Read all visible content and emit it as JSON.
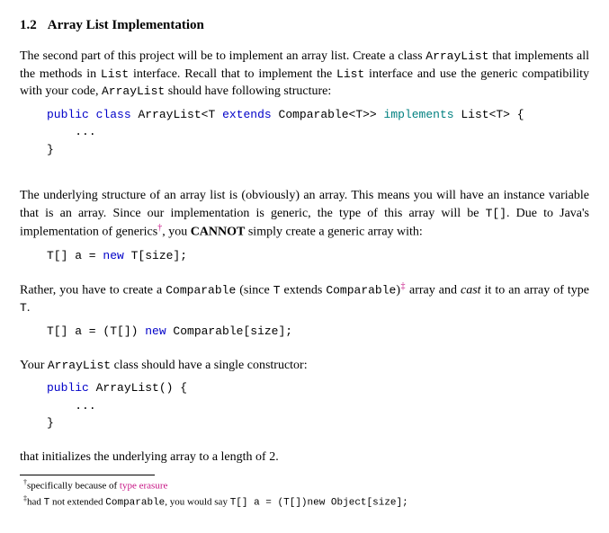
{
  "section": {
    "number": "1.2",
    "title": "Array List Implementation"
  },
  "para1": {
    "t1": "The second part of this project will be to implement an array list. Create a class ",
    "c1": "ArrayList",
    "t2": " that implements all the methods in ",
    "c2": "List",
    "t3": " interface. Recall that to implement the ",
    "c3": "List",
    "t4": " interface and use the generic compatibility with your code, ",
    "c4": "ArrayList",
    "t5": " should have following structure:"
  },
  "code1": {
    "kw_public": "public",
    "kw_class": "class",
    "name": "ArrayList<T",
    "kw_extends": "extends",
    "comp": "Comparable<T>>",
    "kw_implements": "implements",
    "listt": "List<T> {",
    "ellipsis": "...",
    "close": "}"
  },
  "para2": {
    "t1": "The underlying structure of an array list is (obviously) an array.  This means you will have an instance variable that is an array. Since our implementation is generic, the type of this array will be ",
    "c1": "T[]",
    "t2": ". Due to Java's implementation of generics",
    "sup": "†",
    "t3": ", you ",
    "bold": "CANNOT",
    "t4": " simply create a generic array with:"
  },
  "code2": {
    "lhs": "T[] a = ",
    "kw_new": "new",
    "rhs": " T[size];"
  },
  "para3": {
    "t1": "Rather, you have to create a ",
    "c1": "Comparable",
    "t2": " (since ",
    "c2": "T",
    "t3": " extends ",
    "c3": "Comparable",
    "t4": ")",
    "sup": "‡",
    "t5": " array and ",
    "ital": "cast",
    "t6": " it to an array of type ",
    "c4": "T",
    "t7": "."
  },
  "code3": {
    "lhs": "T[] a = (T[]) ",
    "kw_new": "new",
    "rhs": " Comparable[size];"
  },
  "para4": {
    "t1": "Your ",
    "c1": "ArrayList",
    "t2": " class should have a single constructor:"
  },
  "code4": {
    "kw_public": "public",
    "name": " ArrayList() {",
    "ellipsis": "...",
    "close": "}"
  },
  "para5": {
    "t1": "that initializes the underlying array to a length of 2."
  },
  "footnotes": {
    "f1": {
      "mark": "†",
      "text": "specifically because of ",
      "link": "type erasure"
    },
    "f2": {
      "mark": "‡",
      "t1": "had ",
      "c1": "T",
      "t2": " not extended ",
      "c2": "Comparable",
      "t3": ", you would say ",
      "code": "T[] a = (T[])new Object[size];"
    }
  }
}
